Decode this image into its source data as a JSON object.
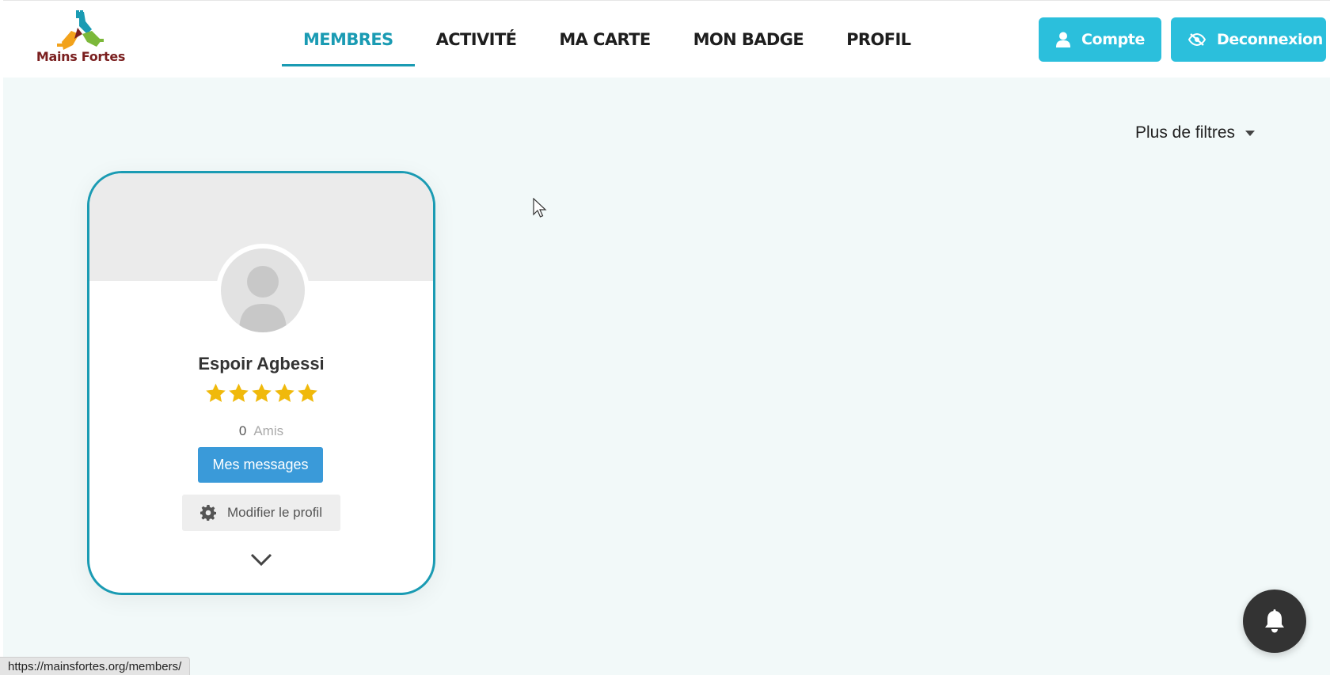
{
  "brand": {
    "logo_text": "Mains Fortes",
    "primary_color": "#1a9bb3",
    "button_color": "#2bbfdc"
  },
  "nav": {
    "items": [
      {
        "label": "MEMBRES",
        "active": true
      },
      {
        "label": "ACTIVITÉ",
        "active": false
      },
      {
        "label": "MA CARTE",
        "active": false
      },
      {
        "label": "MON BADGE",
        "active": false
      },
      {
        "label": "PROFIL",
        "active": false
      }
    ]
  },
  "header_buttons": {
    "account": {
      "label": "Compte",
      "icon": "user-icon"
    },
    "logout": {
      "label": "Deconnexion",
      "icon": "eye-slash-icon"
    }
  },
  "filters": {
    "label": "Plus de filtres"
  },
  "member_card": {
    "name": "Espoir Agbessi",
    "rating": 5,
    "rating_max": 5,
    "friends_count": "0",
    "friends_label": "Amis",
    "messages_button": "Mes messages",
    "edit_button": "Modifier le profil",
    "expand_icon": "chevron-down-icon"
  },
  "notifications": {
    "icon": "bell-icon"
  },
  "status_bar": {
    "url": "https://mainsfortes.org/members/"
  }
}
